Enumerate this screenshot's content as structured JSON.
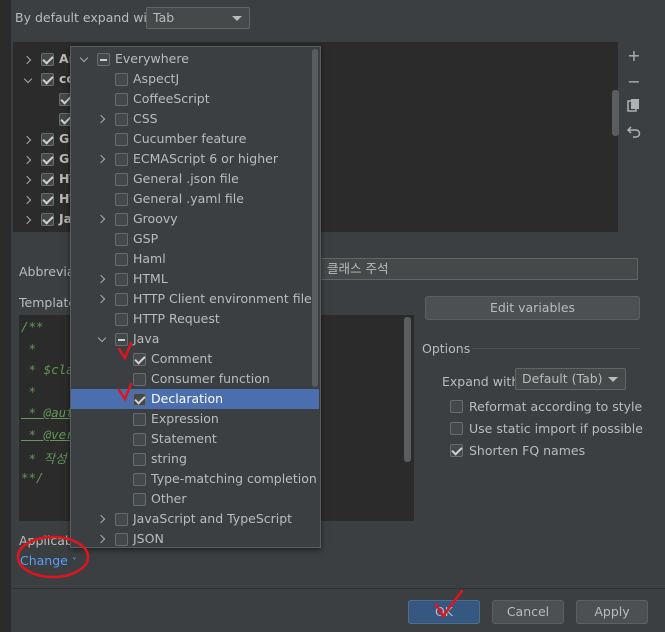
{
  "top": {
    "expand_label": "By default expand with",
    "expand_value": "Tab"
  },
  "tree_rows": [
    {
      "label": "An"
    },
    {
      "label": "co"
    },
    {
      "label": ""
    },
    {
      "label": ""
    },
    {
      "label": "Gr"
    },
    {
      "label": "GS"
    },
    {
      "label": "HT"
    },
    {
      "label": "HT"
    },
    {
      "label": "Ja"
    }
  ],
  "toolbar": {
    "add_icon": "plus-icon",
    "remove_icon": "minus-icon",
    "copy_icon": "copy-icon",
    "restore_icon": "undo-icon"
  },
  "abbrev": {
    "label": "Abbreviati",
    "description_value": "클래스 주석"
  },
  "template": {
    "label": "Template",
    "lines": [
      "/**",
      " *",
      " * $cla",
      " *",
      " * @aut",
      " * @ver",
      " * 작성",
      "**/"
    ]
  },
  "edit_variables_label": "Edit variables",
  "options": {
    "title": "Options",
    "expand_with_label": "Expand with",
    "expand_with_value": "Default (Tab)",
    "reformat_label": "Reformat according to style",
    "static_import_label": "Use static import if possible",
    "shorten_fq_label": "Shorten FQ names"
  },
  "applicable": {
    "label": "Applicabl",
    "change_label": "Change"
  },
  "popup_items": [
    {
      "label": "Everywhere",
      "state": "mixed",
      "chev": "d",
      "level": 0
    },
    {
      "label": "AspectJ",
      "state": "off",
      "chev": "",
      "level": 1
    },
    {
      "label": "CoffeeScript",
      "state": "off",
      "chev": "",
      "level": 1
    },
    {
      "label": "CSS",
      "state": "off",
      "chev": "r",
      "level": 1
    },
    {
      "label": "Cucumber feature",
      "state": "off",
      "chev": "",
      "level": 1
    },
    {
      "label": "ECMAScript 6 or higher",
      "state": "off",
      "chev": "r",
      "level": 1
    },
    {
      "label": "General .json file",
      "state": "off",
      "chev": "",
      "level": 1
    },
    {
      "label": "General .yaml file",
      "state": "off",
      "chev": "",
      "level": 1
    },
    {
      "label": "Groovy",
      "state": "off",
      "chev": "r",
      "level": 1
    },
    {
      "label": "GSP",
      "state": "off",
      "chev": "",
      "level": 1
    },
    {
      "label": "Haml",
      "state": "off",
      "chev": "",
      "level": 1
    },
    {
      "label": "HTML",
      "state": "off",
      "chev": "r",
      "level": 1
    },
    {
      "label": "HTTP Client environment file",
      "state": "off",
      "chev": "r",
      "level": 1
    },
    {
      "label": "HTTP Request",
      "state": "off",
      "chev": "",
      "level": 1
    },
    {
      "label": "Java",
      "state": "mixed",
      "chev": "d",
      "level": 1
    },
    {
      "label": "Comment",
      "state": "on",
      "chev": "",
      "level": 2
    },
    {
      "label": "Consumer function",
      "state": "off",
      "chev": "",
      "level": 2
    },
    {
      "label": "Declaration",
      "state": "on",
      "chev": "",
      "level": 2,
      "selected": true
    },
    {
      "label": "Expression",
      "state": "off",
      "chev": "",
      "level": 2
    },
    {
      "label": "Statement",
      "state": "off",
      "chev": "",
      "level": 2
    },
    {
      "label": "string",
      "state": "off",
      "chev": "",
      "level": 2
    },
    {
      "label": "Type-matching completion",
      "state": "off",
      "chev": "",
      "level": 2
    },
    {
      "label": "Other",
      "state": "off",
      "chev": "",
      "level": 2
    },
    {
      "label": "JavaScript and TypeScript",
      "state": "off",
      "chev": "r",
      "level": 1
    },
    {
      "label": "JSON",
      "state": "off",
      "chev": "r",
      "level": 1
    }
  ],
  "buttons": {
    "ok": "OK",
    "cancel": "Cancel",
    "apply": "Apply"
  }
}
